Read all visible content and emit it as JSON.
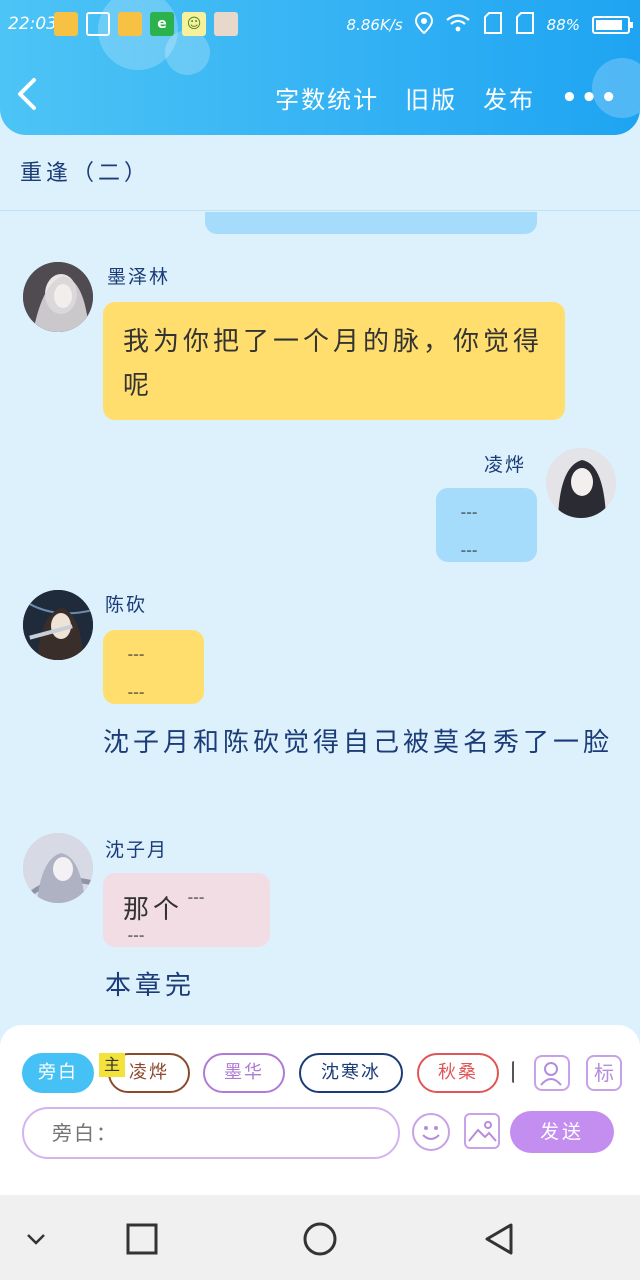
{
  "status_bar": {
    "time": "22:03",
    "net_speed": "8.86K/s",
    "battery": "88%"
  },
  "header": {
    "back_icon": "chevron-left-icon",
    "word_count": "字数统计",
    "old_version": "旧版",
    "publish": "发布",
    "more": "•••"
  },
  "chapter": {
    "title": "重逢（二）"
  },
  "messages": [
    {
      "type": "left",
      "name": "墨泽林",
      "text": "我为你把了一个月的脉，你觉得呢",
      "bubble_color": "#ffde6e"
    },
    {
      "type": "right",
      "name": "凌烨",
      "text": "﹉ ﹉",
      "bubble_color": "#a6dcfb"
    },
    {
      "type": "left",
      "name": "陈砍",
      "text": "﹉ ﹉",
      "bubble_color": "#ffde6e"
    },
    {
      "type": "narration",
      "text": "沈子月和陈砍觉得自己被莫名秀了一脸"
    },
    {
      "type": "left",
      "name": "沈子月",
      "text": "那个﹉ ﹉",
      "bubble_color": "#f2dde4"
    },
    {
      "type": "narration",
      "text": "本章完"
    }
  ],
  "input_panel": {
    "roles": [
      {
        "label": "旁白",
        "color": "#45c1f6"
      },
      {
        "label": "凌烨",
        "color": "#8b4a2e"
      },
      {
        "label": "墨华",
        "color": "#b07ad8"
      },
      {
        "label": "沈寒冰",
        "color": "#1b3c78"
      },
      {
        "label": "秋桑",
        "color": "#e25555"
      }
    ],
    "main_badge": "主",
    "tag_icon": "标",
    "placeholder": "旁白：",
    "send_label": "发送"
  },
  "colors": {
    "header_gradient_start": "#4dc4f5",
    "header_gradient_end": "#1ea4f2",
    "page_bg": "#ddf1fc",
    "accent_purple": "#c48ef0"
  }
}
